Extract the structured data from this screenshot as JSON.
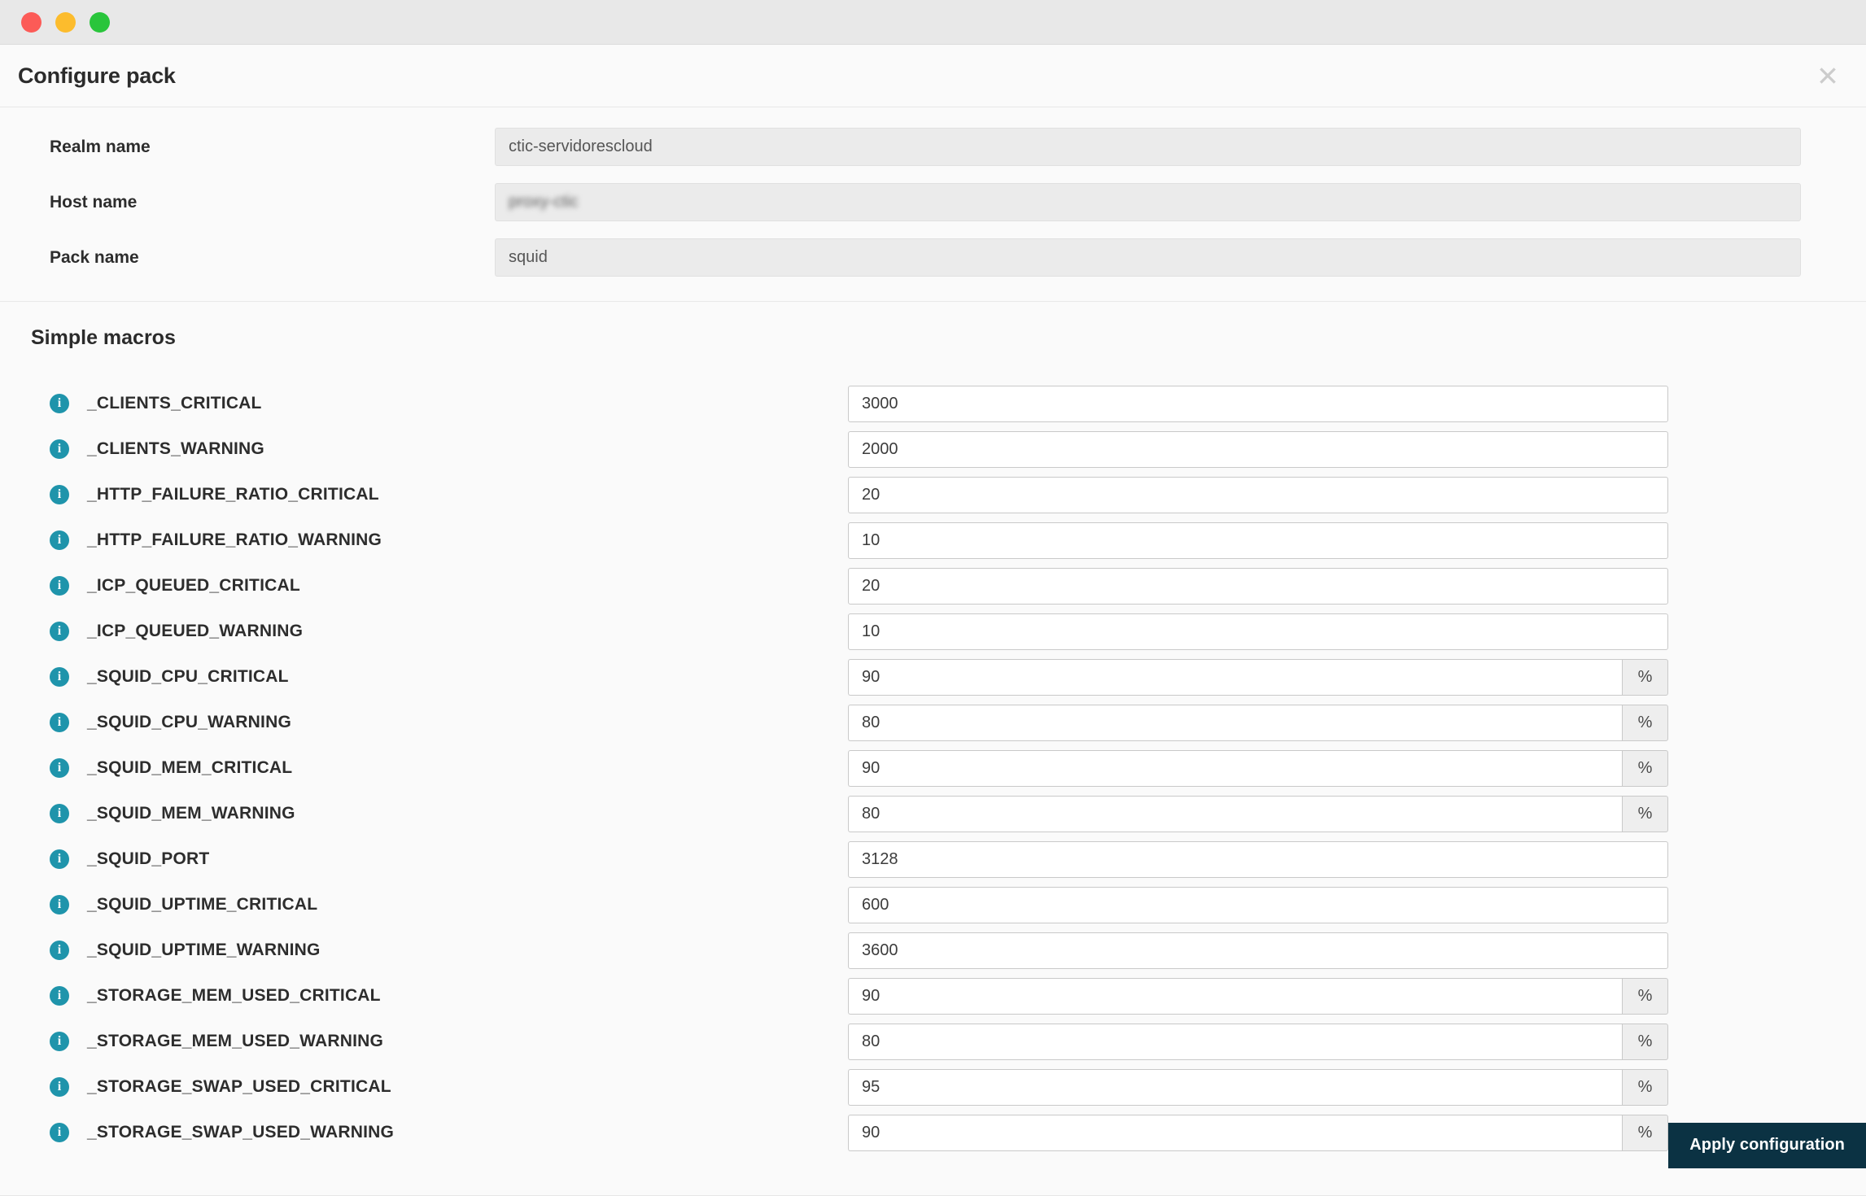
{
  "window": {
    "traffic_lights": [
      {
        "name": "close",
        "color": "#fc5b57"
      },
      {
        "name": "minimize",
        "color": "#fcbc2d"
      },
      {
        "name": "zoom",
        "color": "#29c53b"
      }
    ]
  },
  "header": {
    "title": "Configure pack",
    "close_label": "✖"
  },
  "top_form": {
    "rows": [
      {
        "label": "Realm name",
        "value": "ctic-servidorescloud",
        "blurred": false
      },
      {
        "label": "Host name",
        "value": "proxy-ctic",
        "blurred": true
      },
      {
        "label": "Pack name",
        "value": "squid",
        "blurred": false
      }
    ]
  },
  "macros_section": {
    "title": "Simple macros",
    "info_glyph": "i",
    "items": [
      {
        "name": "_CLIENTS_CRITICAL",
        "value": "3000",
        "suffix": ""
      },
      {
        "name": "_CLIENTS_WARNING",
        "value": "2000",
        "suffix": ""
      },
      {
        "name": "_HTTP_FAILURE_RATIO_CRITICAL",
        "value": "20",
        "suffix": ""
      },
      {
        "name": "_HTTP_FAILURE_RATIO_WARNING",
        "value": "10",
        "suffix": ""
      },
      {
        "name": "_ICP_QUEUED_CRITICAL",
        "value": "20",
        "suffix": ""
      },
      {
        "name": "_ICP_QUEUED_WARNING",
        "value": "10",
        "suffix": ""
      },
      {
        "name": "_SQUID_CPU_CRITICAL",
        "value": "90",
        "suffix": "%"
      },
      {
        "name": "_SQUID_CPU_WARNING",
        "value": "80",
        "suffix": "%"
      },
      {
        "name": "_SQUID_MEM_CRITICAL",
        "value": "90",
        "suffix": "%"
      },
      {
        "name": "_SQUID_MEM_WARNING",
        "value": "80",
        "suffix": "%"
      },
      {
        "name": "_SQUID_PORT",
        "value": "3128",
        "suffix": ""
      },
      {
        "name": "_SQUID_UPTIME_CRITICAL",
        "value": "600",
        "suffix": ""
      },
      {
        "name": "_SQUID_UPTIME_WARNING",
        "value": "3600",
        "suffix": ""
      },
      {
        "name": "_STORAGE_MEM_USED_CRITICAL",
        "value": "90",
        "suffix": "%"
      },
      {
        "name": "_STORAGE_MEM_USED_WARNING",
        "value": "80",
        "suffix": "%"
      },
      {
        "name": "_STORAGE_SWAP_USED_CRITICAL",
        "value": "95",
        "suffix": "%"
      },
      {
        "name": "_STORAGE_SWAP_USED_WARNING",
        "value": "90",
        "suffix": "%"
      }
    ]
  },
  "footer": {
    "apply_label": "Apply configuration"
  },
  "colors": {
    "accent_info": "#1f94ab",
    "apply_button_bg": "#0b3243",
    "titlebar_bg": "#e8e8e8",
    "body_bg": "#fafafa"
  }
}
